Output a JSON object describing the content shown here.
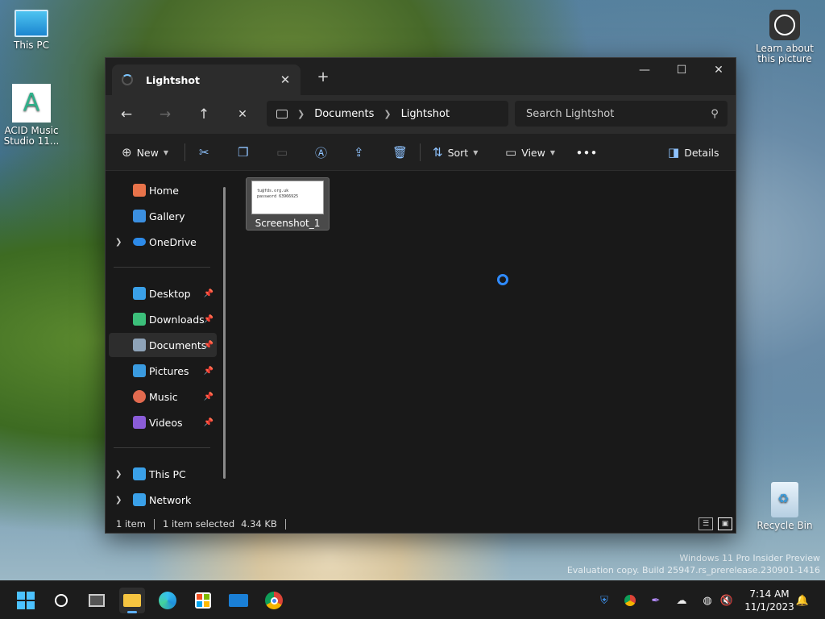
{
  "desktop": {
    "icons": [
      {
        "label": "This PC"
      },
      {
        "label": "ACID Music Studio 11..."
      },
      {
        "label": "Learn about this picture"
      },
      {
        "label": "Recycle Bin"
      }
    ],
    "watermark": {
      "line1": "Windows 11 Pro Insider Preview",
      "line2": "Evaluation copy. Build 25947.rs_prerelease.230901-1416"
    }
  },
  "window": {
    "tab_title": "Lightshot",
    "tab_close": "✕",
    "new_tab": "+",
    "controls": {
      "minimize": "—",
      "maximize": "☐",
      "close": "✕"
    },
    "nav": {
      "back": "←",
      "forward": "→",
      "up": "↑",
      "stop": "✕"
    },
    "breadcrumb": [
      "Documents",
      "Lightshot"
    ],
    "search_placeholder": "Search Lightshot",
    "toolbar": {
      "new_label": "New",
      "sort_label": "Sort",
      "view_label": "View",
      "more_label": "•••",
      "details_label": "Details"
    },
    "sidebar": {
      "quick": [
        {
          "label": "Home",
          "color": "#e8734a"
        },
        {
          "label": "Gallery",
          "color": "#3b8fe0"
        },
        {
          "label": "OneDrive",
          "color": "#2d8ae8"
        }
      ],
      "pinned": [
        {
          "label": "Desktop",
          "color": "#3aa0e8"
        },
        {
          "label": "Downloads",
          "color": "#3cbf7a"
        },
        {
          "label": "Documents",
          "color": "#8ea3b8"
        },
        {
          "label": "Pictures",
          "color": "#3a9be0"
        },
        {
          "label": "Music",
          "color": "#e26a4f"
        },
        {
          "label": "Videos",
          "color": "#8a5cd8"
        }
      ],
      "devices": [
        {
          "label": "This PC",
          "color": "#3aa0e8"
        },
        {
          "label": "Network",
          "color": "#3aa0e8"
        }
      ]
    },
    "files": [
      {
        "name": "Screenshot_1",
        "thumb_line1": "tu@fds.org.uk",
        "thumb_line2": "password 63966925"
      }
    ],
    "status": {
      "count": "1 item",
      "selected": "1 item selected",
      "size": "4.34 KB"
    }
  },
  "taskbar": {
    "clock_time": "7:14 AM",
    "clock_date": "11/1/2023"
  }
}
